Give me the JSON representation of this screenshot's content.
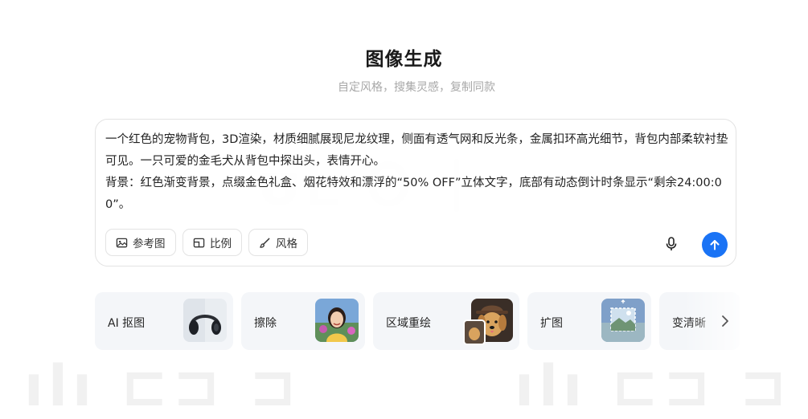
{
  "header": {
    "title": "图像生成",
    "subtitle": "自定风格，搜集灵感，复制同款"
  },
  "prompt": {
    "text": "一个红色的宠物背包，3D渲染，材质细腻展现尼龙纹理，侧面有透气网和反光条，金属扣环高光细节，背包内部柔软衬垫可见。一只可爱的金毛犬从背包中探出头，表情开心。\n背景：红色渐变背景，点缀金色礼盒、烟花特效和漂浮的“50% OFF”立体文字，底部有动态倒计时条显示“剩余24:00:00”。"
  },
  "toolbar": {
    "reference_label": "参考图",
    "ratio_label": "比例",
    "style_label": "风格",
    "mic_icon": "microphone-icon",
    "send_icon": "arrow-up-icon",
    "send_color": "#1a73f5"
  },
  "tools": [
    {
      "label": "AI 抠图",
      "thumb": "headphones"
    },
    {
      "label": "擦除",
      "thumb": "girl-portrait"
    },
    {
      "label": "区域重绘",
      "thumb": "dog-with-hat"
    },
    {
      "label": "扩图",
      "thumb": "landscape-expand"
    },
    {
      "label": "变清晰",
      "thumb": "none"
    }
  ]
}
